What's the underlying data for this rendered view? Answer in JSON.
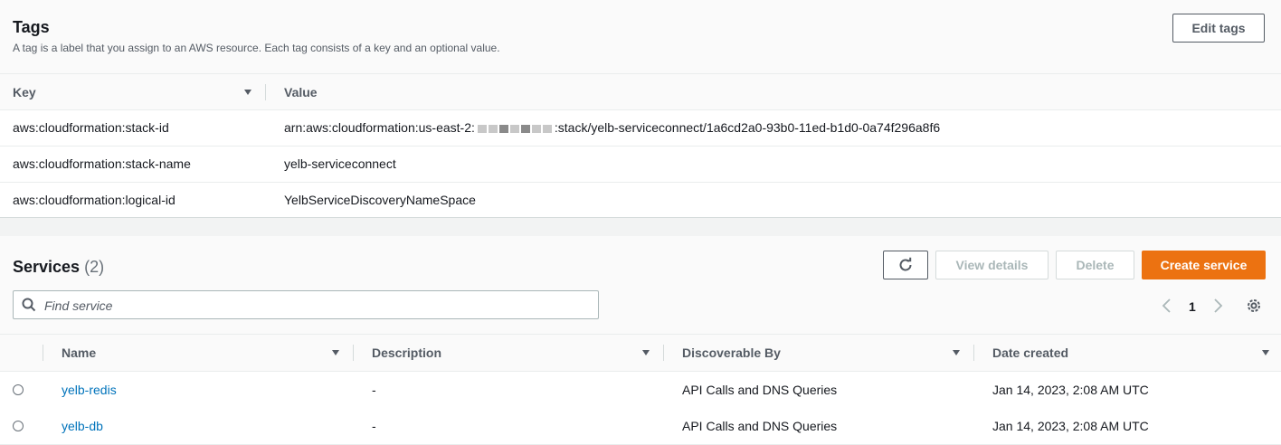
{
  "tags": {
    "title": "Tags",
    "description": "A tag is a label that you assign to an AWS resource. Each tag consists of a key and an optional value.",
    "edit_button": "Edit tags",
    "columns": {
      "key": "Key",
      "value": "Value"
    },
    "rows": [
      {
        "key": "aws:cloudformation:stack-id",
        "value_prefix": "arn:aws:cloudformation:us-east-2:",
        "value_suffix": ":stack/yelb-serviceconnect/1a6cd2a0-93b0-11ed-b1d0-0a74f296a8f6"
      },
      {
        "key": "aws:cloudformation:stack-name",
        "value": "yelb-serviceconnect"
      },
      {
        "key": "aws:cloudformation:logical-id",
        "value": "YelbServiceDiscoveryNameSpace"
      }
    ]
  },
  "services": {
    "title": "Services",
    "count": "(2)",
    "buttons": {
      "view_details": "View details",
      "delete": "Delete",
      "create": "Create service"
    },
    "search_placeholder": "Find service",
    "page": "1",
    "columns": {
      "name": "Name",
      "description": "Description",
      "discoverable_by": "Discoverable By",
      "date_created": "Date created"
    },
    "rows": [
      {
        "name": "yelb-redis",
        "description": "-",
        "discoverable_by": "API Calls and DNS Queries",
        "date_created": "Jan 14, 2023, 2:08 AM UTC"
      },
      {
        "name": "yelb-db",
        "description": "-",
        "discoverable_by": "API Calls and DNS Queries",
        "date_created": "Jan 14, 2023, 2:08 AM UTC"
      }
    ]
  },
  "colors": {
    "primary": "#ec7211",
    "link": "#0073bb"
  },
  "icons": [
    "sort-down-icon",
    "refresh-icon",
    "search-icon",
    "chevron-left-icon",
    "chevron-right-icon",
    "settings-gear-icon"
  ]
}
